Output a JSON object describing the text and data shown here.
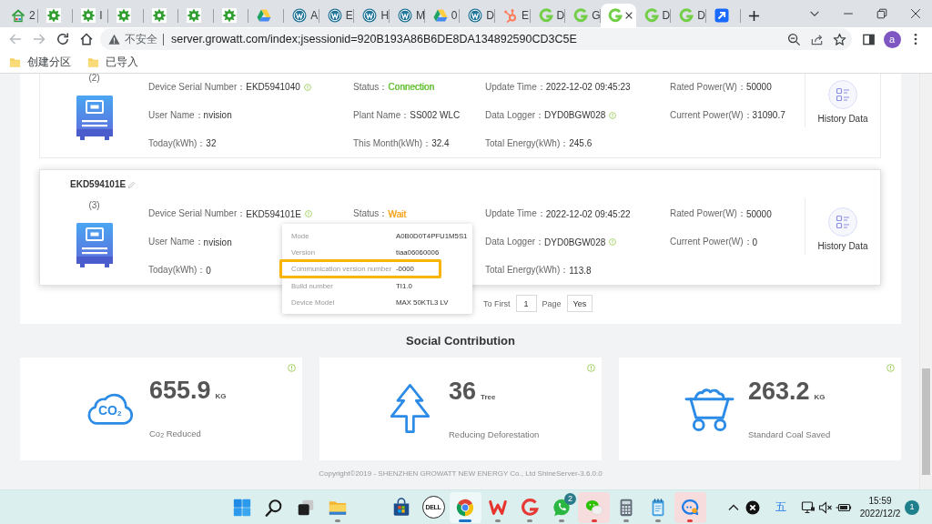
{
  "browser": {
    "tabs": [
      {
        "kind": "house",
        "label": "2",
        "selected": false
      },
      {
        "kind": "gear",
        "selected": false
      },
      {
        "kind": "gear",
        "label": "I",
        "selected": false
      },
      {
        "kind": "gear",
        "selected": false
      },
      {
        "kind": "gear",
        "selected": false
      },
      {
        "kind": "gear",
        "selected": false
      },
      {
        "kind": "gear",
        "selected": false
      },
      {
        "kind": "drive",
        "selected": false
      },
      {
        "kind": "wordpress",
        "label": "A",
        "selected": false
      },
      {
        "kind": "wordpress",
        "label": "E",
        "selected": false
      },
      {
        "kind": "wordpress",
        "label": "H",
        "selected": false
      },
      {
        "kind": "wordpress",
        "label": "M",
        "selected": false
      },
      {
        "kind": "drive",
        "label": "0",
        "selected": false
      },
      {
        "kind": "wordpress",
        "label": "D",
        "selected": false
      },
      {
        "kind": "hubspot",
        "label": "E",
        "selected": false
      },
      {
        "kind": "g",
        "label": "D",
        "selected": false
      },
      {
        "kind": "g",
        "label": "G",
        "selected": false
      },
      {
        "kind": "g",
        "selected": true
      },
      {
        "kind": "g",
        "label": "D",
        "selected": false
      },
      {
        "kind": "g",
        "label": "D",
        "selected": false
      },
      {
        "kind": "arrow",
        "selected": false
      }
    ],
    "navigation": {
      "back": {
        "disabled": true
      },
      "forward": {
        "disabled": true
      }
    },
    "address_bar": {
      "security_label": "不安全",
      "url": "server.growatt.com/index;jsessionid=920B193A86B6DE8DA134892590CD3C5E"
    },
    "profile": {
      "initial": "a"
    },
    "bookmarks": [
      {
        "label": "创建分区"
      },
      {
        "label": "已导入"
      }
    ]
  },
  "page": {
    "devices": [
      {
        "index": "(2)",
        "hovered": false,
        "history_label": "History Data",
        "columns": [
          [
            {
              "label": "Device Serial Number：",
              "value": "EKD5941040",
              "info": true
            },
            {
              "label": "User Name：",
              "value": "nvision",
              "info": false
            },
            {
              "label": "Today(kWh)：",
              "value": "32",
              "info": false
            }
          ],
          [
            {
              "label": "Status：",
              "value": "Connection",
              "color": "#67c23a",
              "info": false
            },
            {
              "label": "Plant Name：",
              "value": "SS002 WLC",
              "info": false
            },
            {
              "label": "This Month(kWh)：",
              "value": "32.4",
              "info": false
            }
          ],
          [
            {
              "label": "Update Time：",
              "value": "2022-12-02 09:45:23",
              "info": false
            },
            {
              "label": "Data Logger：",
              "value": "DYD0BGW028",
              "info": true
            },
            {
              "label": "Total Energy(kWh)：",
              "value": "245.6",
              "info": false
            }
          ],
          [
            {
              "label": "Rated Power(W)：",
              "value": "50000",
              "info": false
            },
            {
              "label": "Current Power(W)：",
              "value": "31090.7",
              "info": false
            }
          ]
        ]
      },
      {
        "title": "EKD594101E",
        "index": "(3)",
        "hovered": true,
        "history_label": "History Data",
        "columns": [
          [
            {
              "label": "Device Serial Number：",
              "value": "EKD594101E",
              "info": true
            },
            {
              "label": "User Name：",
              "value": "nvision",
              "info": false
            },
            {
              "label": "Today(kWh)：",
              "value": "0",
              "info": false
            }
          ],
          [
            {
              "label": "Status：",
              "value": "Wait",
              "color": "#f5a623",
              "info": false
            }
          ],
          [
            {
              "label": "Update Time：",
              "value": "2022-12-02 09:45:22",
              "info": false
            },
            {
              "label": "Data Logger：",
              "value": "DYD0BGW028",
              "info": true
            },
            {
              "label": "Total Energy(kWh)：",
              "value": "113.8",
              "info": false
            }
          ],
          [
            {
              "label": "Rated Power(W)：",
              "value": "50000",
              "info": false
            },
            {
              "label": "Current Power(W)：",
              "value": "0",
              "info": false
            }
          ]
        ],
        "tooltip": {
          "rows": [
            {
              "label": "Mode",
              "value": "A0B0D0T4PFU1M5S1",
              "highlighted": false
            },
            {
              "label": "Version",
              "value": "tiaa06060006",
              "highlighted": false
            },
            {
              "label": "Communication version number",
              "value": "-0000",
              "highlighted": true
            },
            {
              "label": "Build number",
              "value": "TI1.0",
              "highlighted": false
            },
            {
              "label": "Device Model",
              "value": "MAX 50KTL3 LV",
              "highlighted": false
            }
          ]
        }
      }
    ],
    "pagination": {
      "goto_label": "To First",
      "page_value": "1",
      "page_label": "Page",
      "go_button": "Yes"
    },
    "social": {
      "title": "Social Contribution",
      "cards": [
        {
          "kind": "co2",
          "icon_text": "CO$_{2}$",
          "value": "655.9",
          "unit": "KG",
          "label": "Co$_{2}$ Reduced"
        },
        {
          "kind": "tree",
          "value": "36",
          "unit": "Tree",
          "label": "Reducing Deforestation"
        },
        {
          "kind": "coal",
          "value": "263.2",
          "unit": "KG",
          "label": "Standard Coal Saved"
        }
      ]
    },
    "copyright": "Copyright©2019 - SHENZHEN GROWATT NEW ENERGY Co., Ltd ShineServer-3.6.0.0"
  },
  "taskbar": {
    "system_buttons": [
      {
        "kind": "start",
        "running": false,
        "active": false,
        "attention": false
      },
      {
        "kind": "search",
        "running": false,
        "active": false,
        "attention": false
      },
      {
        "kind": "task-view",
        "running": false,
        "active": false,
        "attention": false
      },
      {
        "kind": "explorer",
        "running": true,
        "active": false,
        "attention": false
      }
    ],
    "apps": [
      {
        "kind": "store",
        "running": false,
        "active": false,
        "attention": false
      },
      {
        "kind": "dell",
        "logo_text": "DELL",
        "running": false,
        "active": false,
        "attention": false
      },
      {
        "kind": "chrome",
        "running": true,
        "active": true,
        "attention": false
      },
      {
        "kind": "wps",
        "running": true,
        "active": false,
        "attention": false
      },
      {
        "kind": "g-app",
        "running": true,
        "active": false,
        "attention": false
      },
      {
        "kind": "whatsapp",
        "badge": "2",
        "running": true,
        "active": false,
        "attention": false
      },
      {
        "kind": "wechat",
        "running": true,
        "active": false,
        "attention": true
      },
      {
        "kind": "calculator",
        "running": true,
        "active": false,
        "attention": false
      },
      {
        "kind": "notepad",
        "running": true,
        "active": false,
        "attention": false
      },
      {
        "kind": "chat",
        "running": true,
        "active": false,
        "attention": true
      }
    ],
    "tray": {
      "input_method": "五",
      "time": "15:59",
      "date": "2022/12/2",
      "notification_count": "1"
    }
  }
}
